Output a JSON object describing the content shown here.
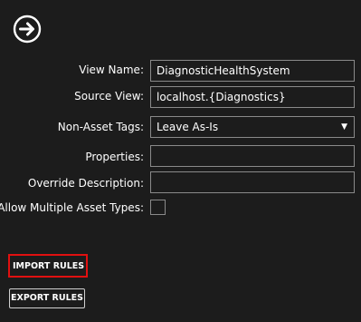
{
  "nav": {
    "icon": "arrow-right-circle-icon"
  },
  "form": {
    "view_name": {
      "label": "View Name:",
      "value": "DiagnosticHealthSystem"
    },
    "source_view": {
      "label": "Source View:",
      "value": "localhost.{Diagnostics}"
    },
    "non_asset_tags": {
      "label": "Non-Asset Tags:",
      "selected": "Leave As-Is"
    },
    "properties": {
      "label": "Properties:",
      "value": ""
    },
    "override_description": {
      "label": "Override Description:",
      "value": ""
    },
    "allow_multiple_asset_types": {
      "label": "Allow Multiple Asset Types:",
      "checked": false
    }
  },
  "actions": {
    "import_label": "IMPORT RULES",
    "export_label": "EXPORT RULES"
  },
  "colors": {
    "background": "#1c1c1c",
    "field_border": "#8a8a8a",
    "highlight": "#e01010"
  }
}
